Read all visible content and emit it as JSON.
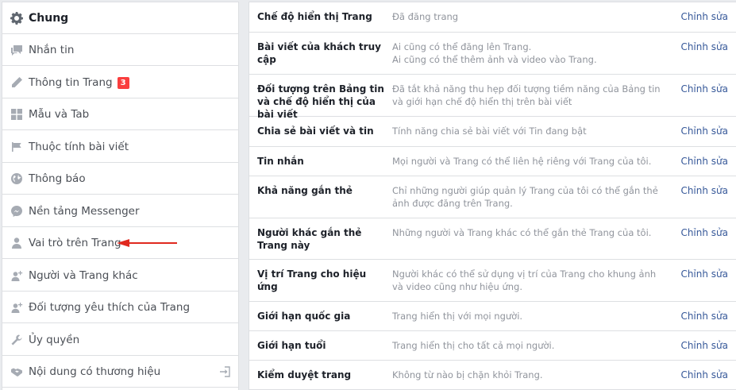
{
  "colors": {
    "link": "#365899",
    "badge": "#fa3e3e",
    "arrow": "#e0291f",
    "icon": "#a6abb3"
  },
  "sidebar": {
    "items": [
      {
        "label": "Chung",
        "icon": "gear-icon",
        "active": true
      },
      {
        "label": "Nhắn tin",
        "icon": "chat-icon"
      },
      {
        "label": "Thông tin Trang",
        "icon": "pencil-icon",
        "badge": "3"
      },
      {
        "label": "Mẫu và Tab",
        "icon": "grid-icon"
      },
      {
        "label": "Thuộc tính bài viết",
        "icon": "flag-icon"
      },
      {
        "label": "Thông báo",
        "icon": "globe-icon"
      },
      {
        "label": "Nền tảng Messenger",
        "icon": "messenger-icon"
      },
      {
        "label": "Vai trò trên Trang",
        "icon": "person-icon"
      },
      {
        "label": "Người và Trang khác",
        "icon": "person-plus-icon"
      },
      {
        "label": "Đối tượng yêu thích của Trang",
        "icon": "person-plus-icon"
      },
      {
        "label": "Ủy quyền",
        "icon": "wrench-icon"
      },
      {
        "label": "Nội dung có thương hiệu",
        "icon": "handshake-icon",
        "trailing_icon": "logout-icon"
      }
    ]
  },
  "settings": {
    "edit_label": "Chỉnh sửa",
    "rows": [
      {
        "name": "Chế độ hiển thị Trang",
        "desc": [
          "Đã đăng trang"
        ]
      },
      {
        "name": "Bài viết của khách truy cập",
        "desc": [
          "Ai cũng có thể đăng lên Trang.",
          "Ai cũng có thể thêm ảnh và video vào Trang."
        ]
      },
      {
        "name": "Đối tượng trên Bảng tin và chế độ hiển thị của bài viết",
        "desc": [
          "Đã tắt khả năng thu hẹp đối tượng tiềm năng của Bảng tin và giới hạn chế độ hiển thị trên bài viết"
        ]
      },
      {
        "name": "Chia sẻ bài viết và tin",
        "desc": [
          "Tính năng chia sẻ bài viết với Tin đang bật"
        ]
      },
      {
        "name": "Tin nhắn",
        "desc": [
          "Mọi người và Trang có thể liên hệ riêng với Trang của tôi."
        ]
      },
      {
        "name": "Khả năng gắn thẻ",
        "desc": [
          "Chỉ những người giúp quản lý Trang của tôi có thể gắn thẻ ảnh được đăng trên Trang."
        ]
      },
      {
        "name": "Người khác gắn thẻ Trang này",
        "desc": [
          "Những người và Trang khác có thể gắn thẻ Trang của tôi."
        ]
      },
      {
        "name": "Vị trí Trang cho hiệu ứng",
        "desc": [
          "Người khác có thể sử dụng vị trí của Trang cho khung ảnh và video cũng như hiệu ứng."
        ]
      },
      {
        "name": "Giới hạn quốc gia",
        "desc": [
          "Trang hiển thị với mọi người."
        ]
      },
      {
        "name": "Giới hạn tuổi",
        "desc": [
          "Trang hiển thị cho tất cả mọi người."
        ]
      },
      {
        "name": "Kiểm duyệt trang",
        "desc": [
          "Không từ nào bị chặn khỏi Trang."
        ]
      }
    ]
  }
}
